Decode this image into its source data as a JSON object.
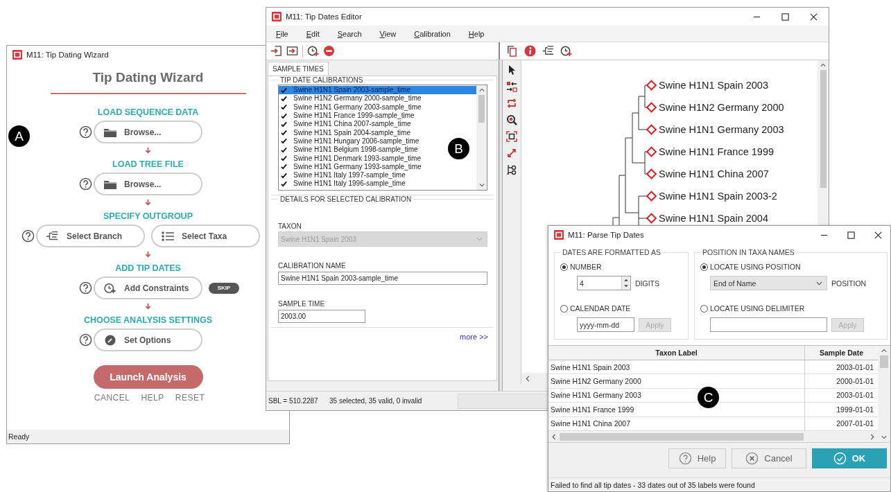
{
  "wizard": {
    "title": "M11: Tip Dating Wizard",
    "marker": "A",
    "heading": "Tip Dating Wizard",
    "steps": [
      {
        "heading": "LOAD SEQUENCE DATA",
        "buttons": [
          {
            "label": "Browse...",
            "kind": "browse"
          }
        ]
      },
      {
        "heading": "LOAD TREE FILE",
        "buttons": [
          {
            "label": "Browse...",
            "kind": "browse"
          }
        ]
      },
      {
        "heading": "SPECIFY OUTGROUP",
        "buttons": [
          {
            "label": "Select Branch",
            "kind": "branch"
          },
          {
            "label": "Select Taxa",
            "kind": "taxa"
          }
        ]
      },
      {
        "heading": "ADD TIP DATES",
        "buttons": [
          {
            "label": "Add Constraints",
            "kind": "constraints"
          }
        ],
        "skip": "SKIP"
      },
      {
        "heading": "CHOOSE ANALYSIS SETTINGS",
        "buttons": [
          {
            "label": "Set Options",
            "kind": "options"
          }
        ]
      }
    ],
    "launch": "Launch Analysis",
    "links": [
      "CANCEL",
      "HELP",
      "RESET"
    ],
    "status": "Ready"
  },
  "editor": {
    "title": "M11: Tip Dates Editor",
    "marker": "B",
    "menu": [
      "File",
      "Edit",
      "Search",
      "View",
      "Calibration",
      "Help"
    ],
    "tab": {
      "label": "SAMPLE TIMES",
      "selected": true
    },
    "calibrations": {
      "title": "TIP DATE CALIBRATIONS",
      "items": [
        {
          "label": "Swine H1N1 Spain 2003-sample_time",
          "checked": true,
          "selected": true
        },
        {
          "label": "Swine H1N2 Germany 2000-sample_time",
          "checked": true,
          "selected": false
        },
        {
          "label": "Swine H1N1 Germany 2003-sample_time",
          "checked": true,
          "selected": false
        },
        {
          "label": "Swine H1N1 France 1999-sample_time",
          "checked": true,
          "selected": false
        },
        {
          "label": "Swine H1N1 China 2007-sample_time",
          "checked": true,
          "selected": false
        },
        {
          "label": "Swine H1N1 Spain 2004-sample_time",
          "checked": true,
          "selected": false
        },
        {
          "label": "Swine H1N1 Hungary 2006-sample_time",
          "checked": true,
          "selected": false
        },
        {
          "label": "Swine H1N1 Belgium 1998-sample_time",
          "checked": true,
          "selected": false
        },
        {
          "label": "Swine H1N1 Denmark 1993-sample_time",
          "checked": true,
          "selected": false
        },
        {
          "label": "Swine H1N1 Germany 1993-sample_time",
          "checked": true,
          "selected": false
        },
        {
          "label": "Swine H1N1 Italy 1997-sample_time",
          "checked": true,
          "selected": false
        },
        {
          "label": "Swine H1N1 Italy 1996-sample_time",
          "checked": true,
          "selected": false
        }
      ]
    },
    "details": {
      "title": "DETAILS FOR SELECTED CALIBRATION",
      "taxon": {
        "label": "TAXON",
        "value": "Swine H1N1 Spain 2003",
        "disabled": true
      },
      "name": {
        "label": "CALIBRATION NAME",
        "value": "Swine H1N1 Spain 2003-sample_time"
      },
      "time": {
        "label": "SAMPLE TIME",
        "value": "2003.00"
      },
      "more": "more >>"
    },
    "tree_tips": [
      "Swine H1N1 Spain 2003",
      "Swine H1N2 Germany 2000",
      "Swine H1N1 Germany 2003",
      "Swine H1N1 France 1999",
      "Swine H1N1 China 2007",
      "Swine H1N1 Spain 2003-2",
      "Swine H1N1 Spain 2004"
    ],
    "status": [
      "SBL = 510.2287",
      "35 selected, 35 valid, 0 invalid"
    ]
  },
  "parse": {
    "title": "M11: Parse Tip Dates",
    "marker": "C",
    "dates": {
      "title": "DATES ARE FORMATTED AS",
      "number": {
        "label": "NUMBER",
        "selected": true,
        "value": "4",
        "unit": "DIGITS"
      },
      "calendar": {
        "label": "CALENDAR DATE",
        "selected": false,
        "placeholder": "yyyy-mm-dd",
        "apply": {
          "label": "Apply",
          "disabled": true
        }
      }
    },
    "position": {
      "title": "POSITION IN TAXA NAMES",
      "by_position": {
        "label": "LOCATE USING POSITION",
        "selected": true,
        "value": "End of Name",
        "unit": "POSITION"
      },
      "by_delimiter": {
        "label": "LOCATE USING DELIMITER",
        "selected": false,
        "apply": {
          "label": "Apply",
          "disabled": true
        }
      }
    },
    "table": {
      "columns": [
        "Taxon Label",
        "Sample Date"
      ],
      "rows": [
        [
          "Swine H1N1 Spain 2003",
          "2003-01-01"
        ],
        [
          "Swine H1N2 Germany 2000",
          "2000-01-01"
        ],
        [
          "Swine H1N1 Germany 2003",
          "2003-01-01"
        ],
        [
          "Swine H1N1 France 1999",
          "1999-01-01"
        ],
        [
          "Swine H1N1 China 2007",
          "2007-01-01"
        ]
      ]
    },
    "buttons": [
      {
        "label": "Help",
        "kind": "help"
      },
      {
        "label": "Cancel",
        "kind": "cancel"
      },
      {
        "label": "OK",
        "kind": "ok"
      }
    ],
    "status": "Failed to find all tip dates - 33 dates out of 35 labels were found"
  }
}
